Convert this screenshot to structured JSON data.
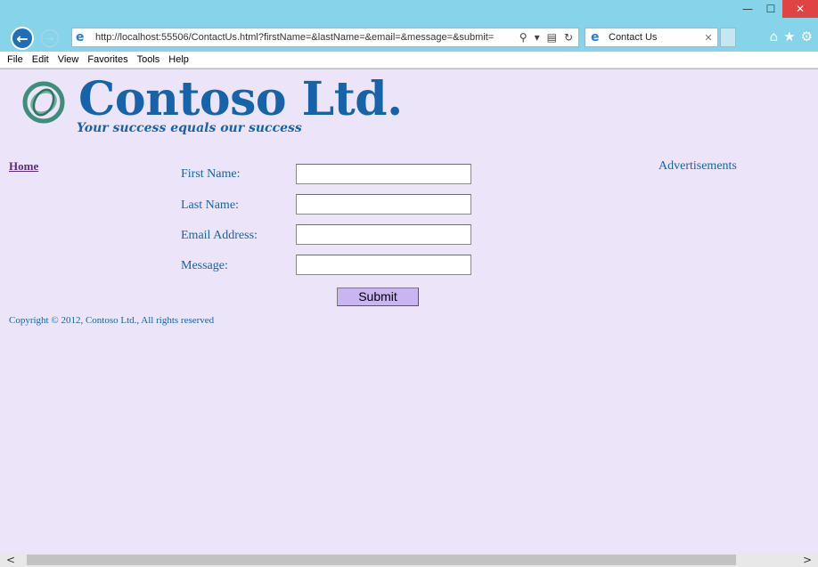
{
  "window": {
    "minimize": "—",
    "maximize": "☐",
    "close": "✕"
  },
  "browser": {
    "address_url": "http://localhost:55506/ContactUs.html?firstName=&lastName=&email=&message=&submit=",
    "tab_title": "Contact Us",
    "icons": [
      "back-icon",
      "forward-icon",
      "ie-icon",
      "search-icon",
      "compat-view-icon",
      "refresh-icon",
      "tab-close-icon",
      "home-icon",
      "favorites-star-icon",
      "settings-gear-icon"
    ]
  },
  "menubar": {
    "items": [
      "File",
      "Edit",
      "View",
      "Favorites",
      "Tools",
      "Help"
    ]
  },
  "header": {
    "brand": "Contoso Ltd.",
    "tagline": "Your success equals our success"
  },
  "nav": {
    "home": "Home"
  },
  "sidebar": {
    "advertisements": "Advertisements"
  },
  "form": {
    "first_name_label": "First Name:",
    "last_name_label": "Last Name:",
    "email_label": "Email Address:",
    "message_label": "Message:",
    "first_name_value": "",
    "last_name_value": "",
    "email_value": "",
    "message_value": "",
    "submit_label": "Submit"
  },
  "footer": {
    "copyright": "Copyright © 2012, Contoso Ltd., All rights reserved"
  },
  "colors": {
    "page_bg": "#ece4f9",
    "brand_blue": "#1763a9",
    "chrome_bg": "#86d4ea",
    "submit_bg": "#c9b6f0",
    "home_link": "#5c2b87"
  }
}
